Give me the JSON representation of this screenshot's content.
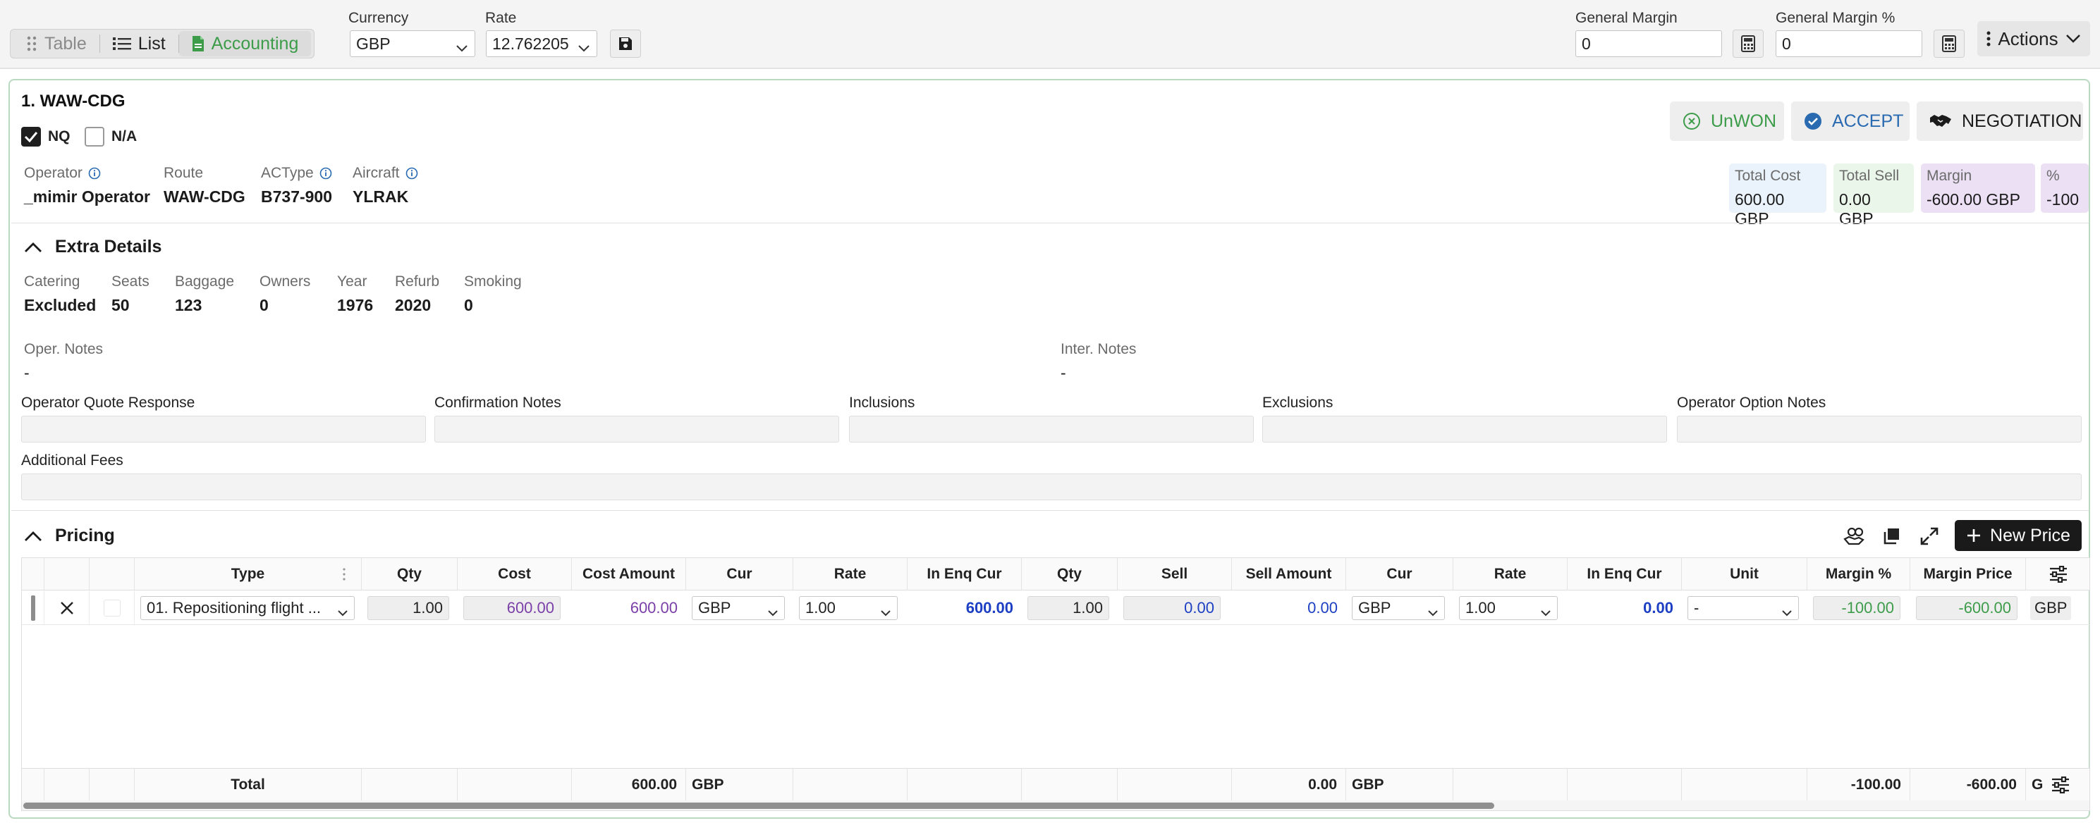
{
  "toolbar": {
    "views": {
      "table": "Table",
      "list": "List",
      "accounting": "Accounting"
    },
    "currency_label": "Currency",
    "currency_value": "GBP",
    "rate_label": "Rate",
    "rate_value": "12.762205",
    "general_margin_label": "General Margin",
    "general_margin_value": "0",
    "general_margin_pct_label": "General Margin %",
    "general_margin_pct_value": "0",
    "actions_label": "Actions"
  },
  "option": {
    "title": "1. WAW-CDG",
    "nq_label": "NQ",
    "nq_checked": true,
    "na_label": "N/A",
    "na_checked": false,
    "buttons": {
      "unwon": "UnWON",
      "accept": "ACCEPT",
      "negotiation": "NEGOTIATION"
    },
    "fields": [
      {
        "label": "Operator",
        "value": "_mimir Operator",
        "info": true
      },
      {
        "label": "Route",
        "value": "WAW-CDG",
        "info": false
      },
      {
        "label": "ACType",
        "value": "B737-900",
        "info": true
      },
      {
        "label": "Aircraft",
        "value": "YLRAK",
        "info": true
      }
    ],
    "totals": {
      "total_cost_label": "Total Cost",
      "total_cost_value": "600.00 GBP",
      "total_sell_label": "Total Sell",
      "total_sell_value": "0.00 GBP",
      "margin_label": "Margin",
      "margin_value": "-600.00 GBP",
      "pct_label": "%",
      "pct_value": "-100"
    },
    "colors": {
      "accent_green": "#3d9c4a",
      "accept_blue": "#2a6ab0",
      "cost_purple": "#7a3fa8",
      "enq_blue": "#1d3fc4"
    }
  },
  "extra": {
    "title": "Extra Details",
    "fields": [
      {
        "label": "Catering",
        "value": "Excluded"
      },
      {
        "label": "Seats",
        "value": "50"
      },
      {
        "label": "Baggage",
        "value": "123"
      },
      {
        "label": "Owners",
        "value": "0"
      },
      {
        "label": "Year",
        "value": "1976"
      },
      {
        "label": "Refurb",
        "value": "2020"
      },
      {
        "label": "Smoking",
        "value": "0"
      }
    ],
    "oper_notes_label": "Oper. Notes",
    "oper_notes_value": "-",
    "inter_notes_label": "Inter. Notes",
    "inter_notes_value": "-",
    "notes_fields": [
      "Operator Quote Response",
      "Confirmation Notes",
      "Inclusions",
      "Exclusions",
      "Operator Option Notes"
    ],
    "additional_fees_label": "Additional Fees"
  },
  "pricing": {
    "title": "Pricing",
    "new_price_label": "New Price",
    "columns": [
      "Type",
      "Qty",
      "Cost",
      "Cost Amount",
      "Cur",
      "Rate",
      "In Enq Cur",
      "Qty",
      "Sell",
      "Sell Amount",
      "Cur",
      "Rate",
      "In Enq Cur",
      "Unit",
      "Margin %",
      "Margin Price"
    ],
    "row": {
      "type": "01. Repositioning flight ...",
      "qty": "1.00",
      "cost": "600.00",
      "cost_amount": "600.00",
      "cur": "GBP",
      "rate": "1.00",
      "in_enq_cur": "600.00",
      "sell_qty": "1.00",
      "sell": "0.00",
      "sell_amount": "0.00",
      "sell_cur": "GBP",
      "sell_rate": "1.00",
      "sell_in_enq_cur": "0.00",
      "unit": "-",
      "margin_pct": "-100.00",
      "margin_price": "-600.00",
      "trailing_cur": "GBP"
    },
    "footer": {
      "label": "Total",
      "cost_amount": "600.00",
      "cost_cur": "GBP",
      "sell_amount": "0.00",
      "sell_cur": "GBP",
      "margin_pct": "-100.00",
      "margin_price": "-600.00",
      "trailing": "G"
    }
  }
}
